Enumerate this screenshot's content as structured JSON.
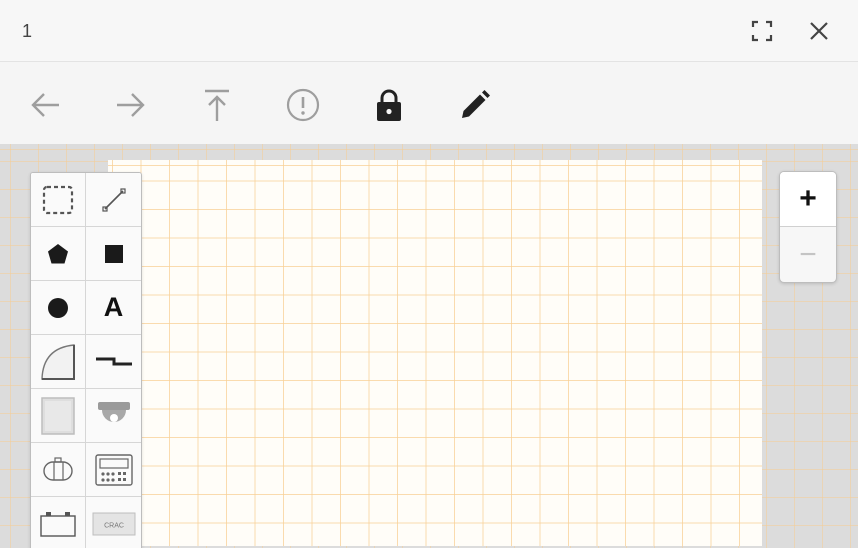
{
  "window": {
    "title": "1",
    "fullscreen_icon": "fullscreen-icon",
    "close_icon": "close-icon"
  },
  "toolbar": {
    "tools": [
      {
        "name": "undo",
        "icon": "arrow-left-icon",
        "enabled": false
      },
      {
        "name": "redo",
        "icon": "arrow-right-icon",
        "enabled": false
      },
      {
        "name": "bring-to-top",
        "icon": "arrow-up-to-line-icon",
        "enabled": false
      },
      {
        "name": "info",
        "icon": "exclamation-circle-icon",
        "enabled": false
      },
      {
        "name": "lock",
        "icon": "lock-icon",
        "enabled": true
      },
      {
        "name": "edit",
        "icon": "pencil-icon",
        "enabled": true
      }
    ]
  },
  "palette": {
    "items": [
      {
        "name": "select",
        "icon": "dashed-rectangle-icon"
      },
      {
        "name": "line",
        "icon": "line-icon"
      },
      {
        "name": "polygon",
        "icon": "pentagon-icon"
      },
      {
        "name": "rectangle",
        "icon": "square-icon"
      },
      {
        "name": "circle",
        "icon": "circle-icon"
      },
      {
        "name": "text",
        "icon": "text-icon",
        "label": "A"
      },
      {
        "name": "door-swing",
        "icon": "door-swing-icon"
      },
      {
        "name": "wall-break",
        "icon": "wall-line-icon"
      },
      {
        "name": "panel",
        "icon": "panel-icon"
      },
      {
        "name": "dome-camera",
        "icon": "dome-camera-icon"
      },
      {
        "name": "tank",
        "icon": "tank-icon"
      },
      {
        "name": "controller",
        "icon": "controller-icon"
      },
      {
        "name": "battery",
        "icon": "battery-icon"
      },
      {
        "name": "crac",
        "icon": "crac-unit-icon",
        "label": "CRAC"
      }
    ]
  },
  "zoom": {
    "in_label": "+",
    "out_label": "−"
  },
  "colors": {
    "grid_line": "#f5cd96",
    "canvas_bg": "#dcdcdc",
    "page_bg": "#fffdf8",
    "disabled_icon": "#9e9e9e",
    "active_icon": "#222222"
  }
}
